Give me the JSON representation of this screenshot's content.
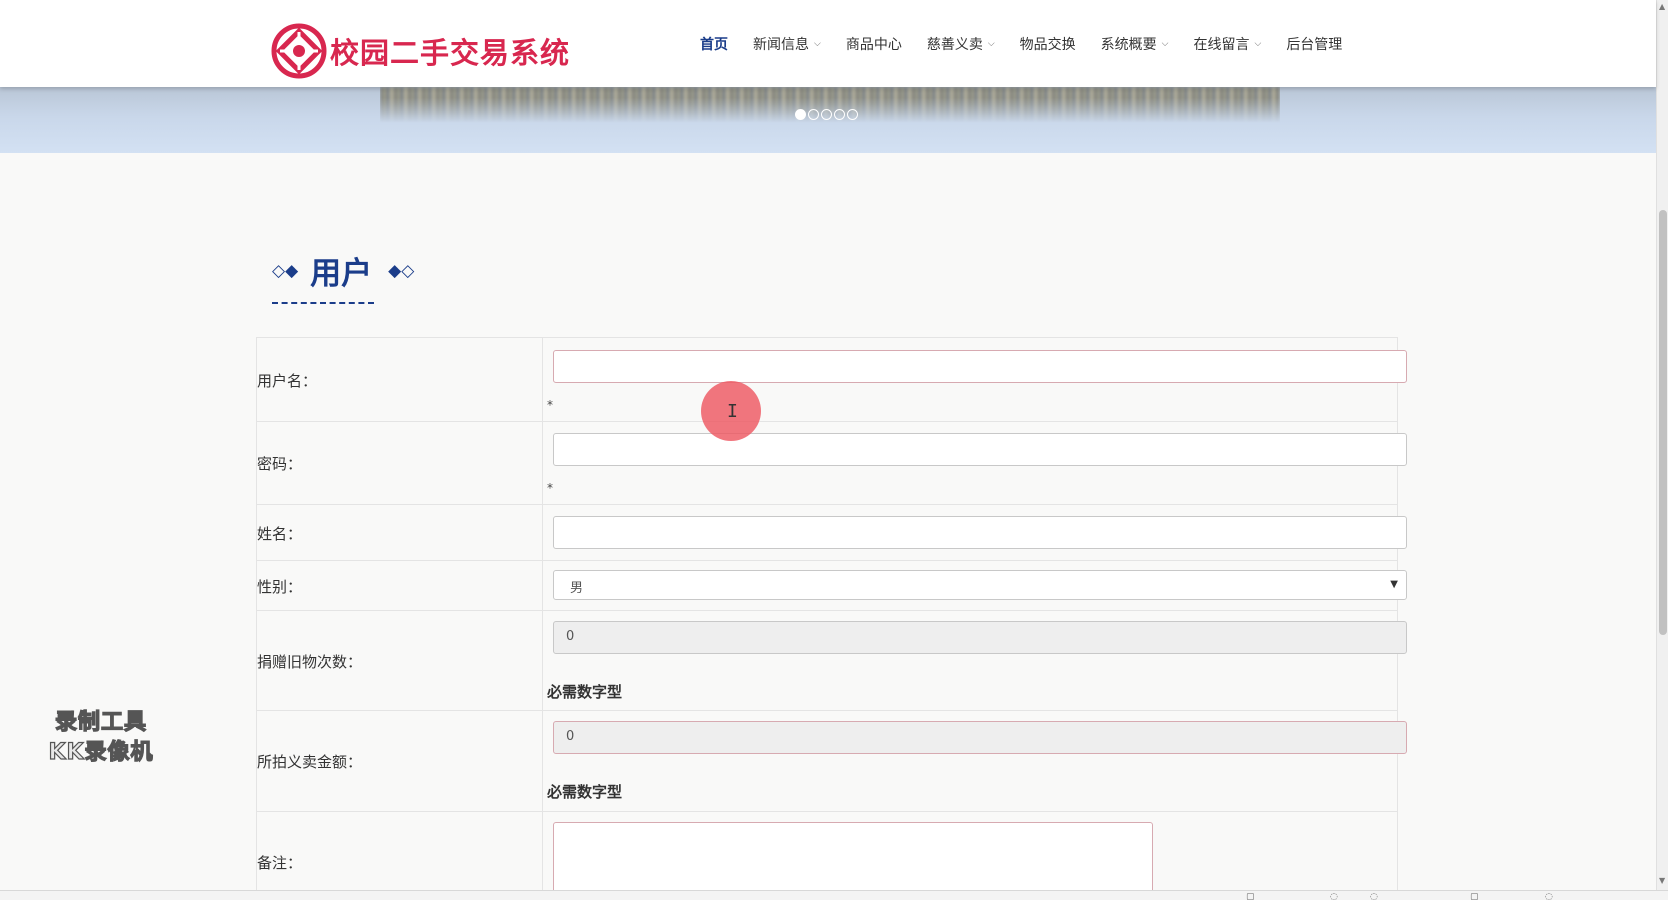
{
  "header": {
    "logo_text": "校园二手交易系统",
    "nav": [
      {
        "label": "首页",
        "active": true,
        "dropdown": false
      },
      {
        "label": "新闻信息",
        "active": false,
        "dropdown": true
      },
      {
        "label": "商品中心",
        "active": false,
        "dropdown": false
      },
      {
        "label": "慈善义卖",
        "active": false,
        "dropdown": true
      },
      {
        "label": "物品交换",
        "active": false,
        "dropdown": false
      },
      {
        "label": "系统概要",
        "active": false,
        "dropdown": true
      },
      {
        "label": "在线留言",
        "active": false,
        "dropdown": true
      },
      {
        "label": "后台管理",
        "active": false,
        "dropdown": false
      }
    ]
  },
  "banner": {
    "slide_count": 5,
    "active_slide": 1
  },
  "section": {
    "title": "用户",
    "left_deco": "◇◆",
    "right_deco": "◆◇"
  },
  "form": {
    "username_label": "用户名：",
    "username_value": "",
    "username_required": "*",
    "password_label": "密码：",
    "password_value": "",
    "password_required": "*",
    "name_label": "姓名：",
    "name_value": "",
    "gender_label": "性别：",
    "gender_value": "男",
    "donation_count_label": "捐赠旧物次数：",
    "donation_count_value": "0",
    "donation_count_hint": "必需数字型",
    "charity_amount_label": "所拍义卖金额：",
    "charity_amount_value": "0",
    "charity_amount_hint": "必需数字型",
    "remark_label": "备注："
  },
  "watermark": {
    "line1": "录制工具",
    "line2": "KK录像机"
  },
  "colors": {
    "brand": "#d8274f",
    "nav_active": "#1b3d8a",
    "cursor": "#ee5862"
  }
}
